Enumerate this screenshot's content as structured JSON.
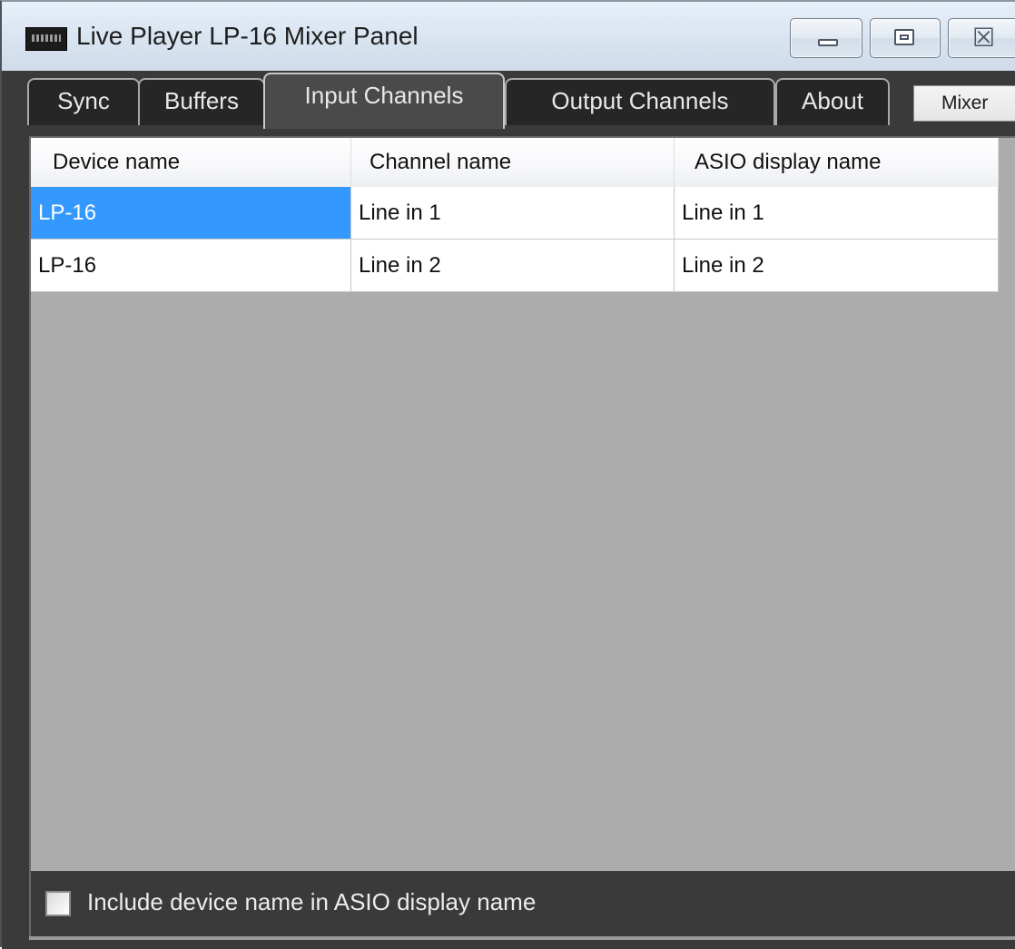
{
  "window": {
    "title": "Live Player LP-16 Mixer Panel",
    "controls": {
      "minimize_icon": "minimize-icon",
      "maximize_icon": "maximize-icon",
      "close_icon": "close-icon",
      "close_glyph": "☒"
    }
  },
  "tabs": [
    {
      "label": "Sync",
      "active": false
    },
    {
      "label": "Buffers",
      "active": false
    },
    {
      "label": "Input Channels",
      "active": true
    },
    {
      "label": "Output Channels",
      "active": false
    },
    {
      "label": "About",
      "active": false
    }
  ],
  "mixer_button": {
    "label": "Mixer"
  },
  "grid": {
    "columns": [
      "Device name",
      "Channel name",
      "ASIO display name"
    ],
    "rows": [
      {
        "device": "LP-16",
        "channel": "Line in 1",
        "asio": "Line in 1",
        "selected_cell": "device"
      },
      {
        "device": "LP-16",
        "channel": "Line in 2",
        "asio": "Line in 2"
      }
    ]
  },
  "options": {
    "include_device_name": {
      "label": "Include device name in ASIO display name",
      "checked": false
    }
  },
  "colors": {
    "selection": "#3399ff",
    "panel_background": "#3a3a3a",
    "grid_empty_area": "#acacac"
  }
}
